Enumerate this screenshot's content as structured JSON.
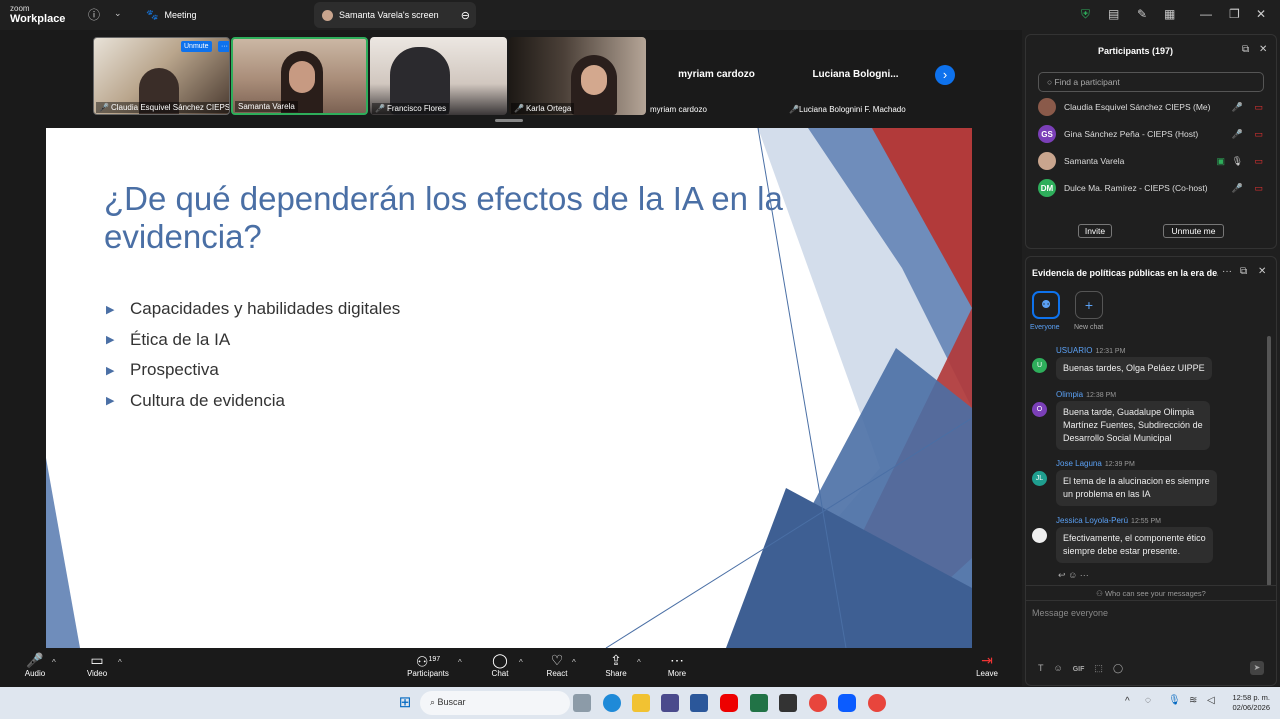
{
  "app": {
    "brand_small": "zoom",
    "brand_big": "Workplace"
  },
  "titlebar": {
    "tabs": [
      {
        "label": "Meeting"
      },
      {
        "label": "Samanta Varela's screen"
      }
    ]
  },
  "strip": {
    "self_unmute": "Unmute",
    "self_more": "···",
    "tiles": [
      {
        "name": "Claudia Esquivel Sánchez CIEPS"
      },
      {
        "name": "Samanta Varela"
      },
      {
        "name": "Francisco Flores"
      },
      {
        "name": "Karla Ortega"
      },
      {
        "name": "myriam cardozo",
        "display": "myriam cardozo"
      },
      {
        "name": "Luciana Bolognini F. Machado",
        "display": "Luciana  Bologni..."
      }
    ]
  },
  "slide": {
    "title": "¿De qué dependerán los efectos de la IA en la evidencia?",
    "bullets": [
      "Capacidades y habilidades digitales",
      "Ética de la IA",
      "Prospectiva",
      "Cultura de evidencia"
    ],
    "bullet_glyph": "▶"
  },
  "participants": {
    "title": "Participants (197)",
    "search_placeholder": "Find a participant",
    "list": [
      {
        "name": "Claudia Esquivel Sánchez CIEPS (Me)",
        "initials": "",
        "color": "#8a5a4a"
      },
      {
        "name": "Gina Sánchez Peña - CIEPS (Host)",
        "initials": "GS",
        "color": "#7b3fb8"
      },
      {
        "name": "Samanta Varela",
        "initials": "",
        "color": "#c9a58e"
      },
      {
        "name": "Dulce Ma. Ramírez - CIEPS (Co-host)",
        "initials": "DM",
        "color": "#2eae5b"
      }
    ],
    "invite": "Invite",
    "unmute_me": "Unmute me"
  },
  "chat": {
    "title": "Evidencia de políticas públicas en la era de...",
    "everyone": "Everyone",
    "new_chat": "New chat",
    "messages": [
      {
        "sender": "USUARIO",
        "time": "12:31 PM",
        "initials": "U",
        "color": "#2eae5b",
        "lines": [
          "Buenas tardes, Olga Peláez UIPPE"
        ]
      },
      {
        "sender": "Olimpia",
        "time": "12:38 PM",
        "initials": "O",
        "color": "#7b3fb8",
        "lines": [
          "Buena tarde, Guadalupe Olimpia",
          "Martínez Fuentes, Subdirección de",
          "Desarrollo Social Municipal"
        ]
      },
      {
        "sender": "Jose Laguna",
        "time": "12:39 PM",
        "initials": "JL",
        "color": "#1f9e8f",
        "lines": [
          "El tema de la alucinacion es siempre",
          "un problema en las IA"
        ]
      },
      {
        "sender": "Jessica Loyola-Perú",
        "time": "12:55 PM",
        "initials": "",
        "color": "#eeeeee",
        "lines": [
          "Efectivamente, el componente ético",
          "siempre debe estar presente."
        ]
      }
    ],
    "who_can_see": "Who can see your messages?",
    "input_placeholder": "Message everyone",
    "gif": "GIF"
  },
  "toolbar": {
    "audio": "Audio",
    "video": "Video",
    "participants": "Participants",
    "participants_count": "197",
    "chat": "Chat",
    "react": "React",
    "share": "Share",
    "more": "More",
    "leave": "Leave"
  },
  "taskbar": {
    "search_placeholder": "Buscar",
    "time": "12:58 p. m.",
    "date": "02/06/2026"
  }
}
